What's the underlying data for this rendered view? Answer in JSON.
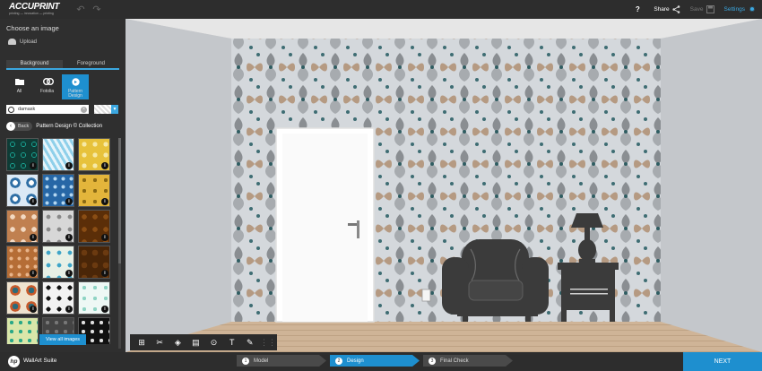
{
  "app": {
    "brand": "ACCUPRINT",
    "tagline": "printing — innovation — printing"
  },
  "topbar": {
    "help": "?",
    "share": "Share",
    "save": "Save",
    "settings": "Settings"
  },
  "sidebar": {
    "title": "Choose an image",
    "upload": "Upload",
    "tabs": [
      {
        "label": "Background",
        "active": true
      },
      {
        "label": "Foreground",
        "active": false
      }
    ],
    "sources": [
      {
        "label": "All",
        "icon": "folder-icon"
      },
      {
        "label": "Fotolia",
        "icon": "fotolia-icon"
      },
      {
        "label": "Pattern Design",
        "icon": "pattern-design-icon",
        "active": true
      }
    ],
    "search": {
      "value": "damask",
      "placeholder": ""
    },
    "back": "Back",
    "collection": "Pattern Design © Collection",
    "info": "i",
    "view_all": "View all images"
  },
  "bottombar": {
    "hp": "hp",
    "suite": "WallArt Suite",
    "steps": [
      {
        "num": "1",
        "label": "Model"
      },
      {
        "num": "2",
        "label": "Design",
        "active": true
      },
      {
        "num": "3",
        "label": "Final Check"
      }
    ],
    "next": "NEXT"
  },
  "colors": {
    "accent": "#1e8fcf",
    "wallpaper_bg": "#d4d8dc",
    "wallpaper_motif": "#8a8e92",
    "furniture": "#3b3b3b",
    "floor": "#c9a98a"
  }
}
